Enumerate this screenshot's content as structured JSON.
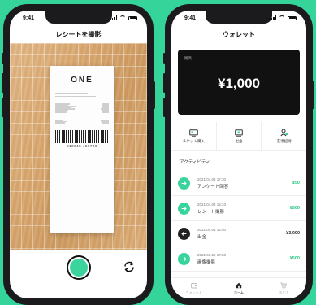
{
  "colors": {
    "background": "#34d49a",
    "accent": "#37d49b",
    "amount_positive": "#27c484",
    "card": "#111111"
  },
  "left_phone": {
    "status": {
      "time": "9:41"
    },
    "title": "レシートを撮影",
    "receipt": {
      "brand": "ONE",
      "barcode_number": "012345 456789"
    },
    "shutter_icon": "shutter-button",
    "flip_icon": "camera-flip-icon"
  },
  "right_phone": {
    "status": {
      "time": "9:41"
    },
    "title": "ウォレット",
    "card": {
      "caption": "残高",
      "amount": "¥1,000"
    },
    "actions": [
      {
        "label": "チケット購入",
        "icon": "ticket-icon"
      },
      {
        "label": "出金",
        "icon": "withdraw-icon"
      },
      {
        "label": "友達招待",
        "icon": "invite-friend-icon"
      }
    ],
    "activity_label": "アクティビティ",
    "activities": [
      {
        "date": "2021.04.02 17:30",
        "title": "アンケート回答",
        "amount": "¥50",
        "type": "in"
      },
      {
        "date": "2021.04.02 15:33",
        "title": "レシート撮影",
        "amount": "¥500",
        "type": "in"
      },
      {
        "date": "2021.04.01 14:50",
        "title": "出金",
        "amount": "-¥3,000",
        "type": "out"
      },
      {
        "date": "2021.03.29 17:23",
        "title": "画像撮影",
        "amount": "¥500",
        "type": "in"
      }
    ],
    "tabs": [
      {
        "label": "ウォレット",
        "icon": "wallet-icon"
      },
      {
        "label": "ホーム",
        "icon": "home-icon",
        "active": true
      },
      {
        "label": "ストア",
        "icon": "cart-icon"
      }
    ]
  }
}
